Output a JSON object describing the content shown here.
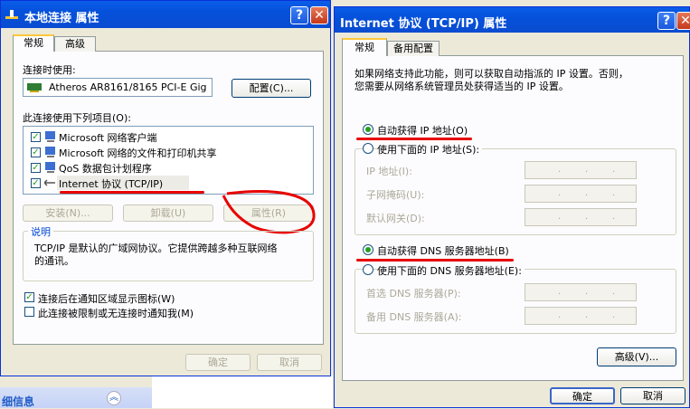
{
  "left_window": {
    "title": "本地连接 属性",
    "tabs": [
      "常规",
      "高级"
    ],
    "connect_using_label": "连接时使用:",
    "adapter_name": "Atheros AR8161/8165 PCI-E Gig",
    "configure_button": "配置(C)...",
    "items_label": "此连接使用下列项目(O):",
    "items": [
      "Microsoft 网络客户端",
      "Microsoft 网络的文件和打印机共享",
      "QoS 数据包计划程序",
      "Internet 协议 (TCP/IP)"
    ],
    "install_button": "安装(N)...",
    "uninstall_button": "卸载(U)",
    "properties_button": "属性(R)",
    "description_title": "说明",
    "description_text_line1": "TCP/IP 是默认的广域网协议。它提供跨越多种互联网络",
    "description_text_line2": "的通讯。",
    "show_icon_label": "连接后在通知区域显示图标(W)",
    "notify_label": "此连接被限制或无连接时通知我(M)",
    "ok_button": "确定",
    "cancel_button": "取消"
  },
  "right_window": {
    "title": "Internet 协议 (TCP/IP) 属性",
    "tabs": [
      "常规",
      "备用配置"
    ],
    "intro_line1": "如果网络支持此功能，则可以获取自动指派的 IP 设置。否则，",
    "intro_line2": "您需要从网络系统管理员处获得适当的 IP 设置。",
    "auto_ip": "自动获得 IP 地址(O)",
    "manual_ip": "使用下面的 IP 地址(S):",
    "ip_address_label": "IP 地址(I):",
    "subnet_label": "子网掩码(U):",
    "gateway_label": "默认网关(D):",
    "auto_dns": "自动获得 DNS 服务器地址(B)",
    "manual_dns": "使用下面的 DNS 服务器地址(E):",
    "preferred_dns_label": "首选 DNS 服务器(P):",
    "alternate_dns_label": "备用 DNS 服务器(A):",
    "advanced_button": "高级(V)...",
    "ok_button": "确定",
    "cancel_button": "取消"
  },
  "bottom_panel": {
    "title": "细信息"
  },
  "colors": {
    "title_blue": "#0a5de8",
    "annotation_red": "#e80000"
  }
}
